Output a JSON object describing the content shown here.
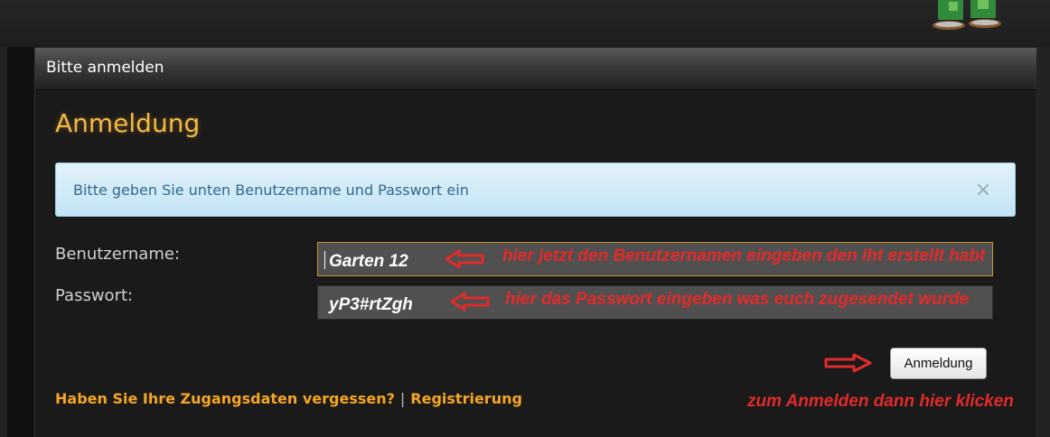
{
  "panel": {
    "title": "Bitte anmelden",
    "heading": "Anmeldung"
  },
  "alert": {
    "text": "Bitte geben Sie unten Benutzername und Passwort ein",
    "close_icon": "close-icon",
    "close_glyph": "×"
  },
  "form": {
    "username_label": "Benutzername:",
    "username_value": "Garten 12",
    "password_label": "Passwort:",
    "password_value": "yP3#rtZgh",
    "submit_label": "Anmeldung"
  },
  "annotations": {
    "username": "hier jetzt den Benutzernamen eingeben den iht erstellt habt",
    "password": "hier das Passwort eingeben was euch zugesendet wurde",
    "login": "zum Anmelden dann hier klicken",
    "arrow_icon": "red-arrow-icon"
  },
  "links": {
    "forgot": "Haben Sie Ihre Zugangsdaten vergessen?",
    "separator": "|",
    "register": "Registrierung"
  },
  "colors": {
    "heading": "#f5b843",
    "link": "#f5a623",
    "annotation": "#e32a2a",
    "alert_bg": "#d4ecf7"
  }
}
